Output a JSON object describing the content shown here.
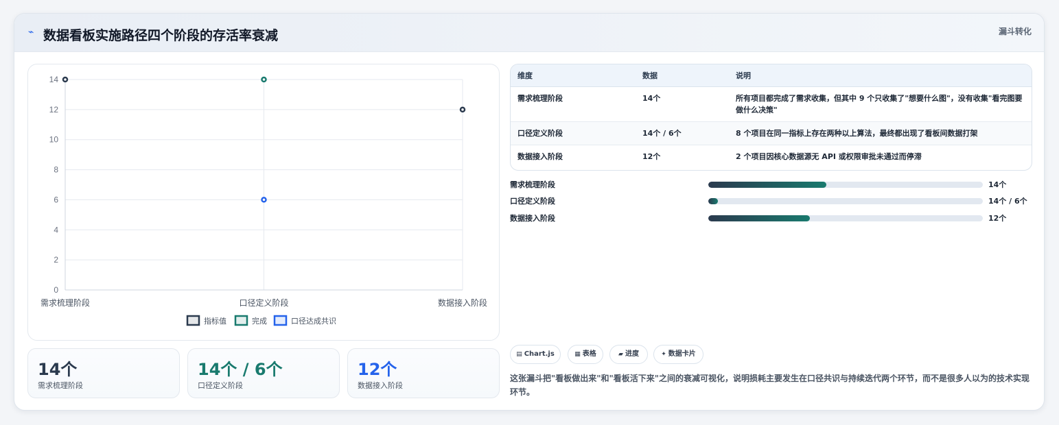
{
  "header": {
    "icon": "lightning-icon",
    "title": "数据看板实施路径四个阶段的存活率衰减",
    "tag": "漏斗转化"
  },
  "colors": {
    "dark": "#2b3a4e",
    "green": "#197a6e",
    "blue": "#2563eb"
  },
  "chart_data": {
    "type": "scatter",
    "categories": [
      "需求梳理阶段",
      "口径定义阶段",
      "数据接入阶段"
    ],
    "series": [
      {
        "name": "指标值",
        "color": "#2b3a4e",
        "values": [
          14,
          null,
          12
        ]
      },
      {
        "name": "完成",
        "color": "#197a6e",
        "values": [
          null,
          14,
          null
        ]
      },
      {
        "name": "口径达成共识",
        "color": "#2563eb",
        "values": [
          null,
          6,
          null
        ]
      }
    ],
    "yticks": [
      "0",
      "2",
      "4",
      "6",
      "8",
      "10",
      "12",
      "14"
    ],
    "ylim": [
      0,
      14
    ],
    "grid": true,
    "legend": "bottom"
  },
  "kpis": [
    {
      "value": "14个",
      "label": "需求梳理阶段",
      "color": "#2b3a4e"
    },
    {
      "value": "14个 / 6个",
      "label": "口径定义阶段",
      "color": "#197a6e"
    },
    {
      "value": "12个",
      "label": "数据接入阶段",
      "color": "#2563eb"
    }
  ],
  "table": {
    "headers": [
      "维度",
      "数据",
      "说明"
    ],
    "rows": [
      [
        "需求梳理阶段",
        "14个",
        "所有项目都完成了需求收集，但其中 9 个只收集了\"想要什么图\"，没有收集\"看完图要做什么决策\""
      ],
      [
        "口径定义阶段",
        "14个 / 6个",
        "8 个项目在同一指标上存在两种以上算法，最终都出现了看板间数据打架"
      ],
      [
        "数据接入阶段",
        "12个",
        "2 个项目因核心数据源无 API 或权限审批未通过而停滞"
      ]
    ]
  },
  "progress": [
    {
      "label": "需求梳理阶段",
      "value": "14个",
      "fraction": 0.43
    },
    {
      "label": "口径定义阶段",
      "value": "14个 / 6个",
      "fraction": 0.035
    },
    {
      "label": "数据接入阶段",
      "value": "12个",
      "fraction": 0.37
    }
  ],
  "chips": [
    {
      "icon": "chart-icon",
      "glyph": "▤",
      "label": "Chart.js"
    },
    {
      "icon": "table-icon",
      "glyph": "▦",
      "label": "表格"
    },
    {
      "icon": "progress-icon",
      "glyph": "▰",
      "label": "进度"
    },
    {
      "icon": "card-icon",
      "glyph": "✦",
      "label": "数据卡片"
    }
  ],
  "description": "这张漏斗把\"看板做出来\"和\"看板活下来\"之间的衰减可视化，说明损耗主要发生在口径共识与持续迭代两个环节，而不是很多人以为的技术实现环节。"
}
